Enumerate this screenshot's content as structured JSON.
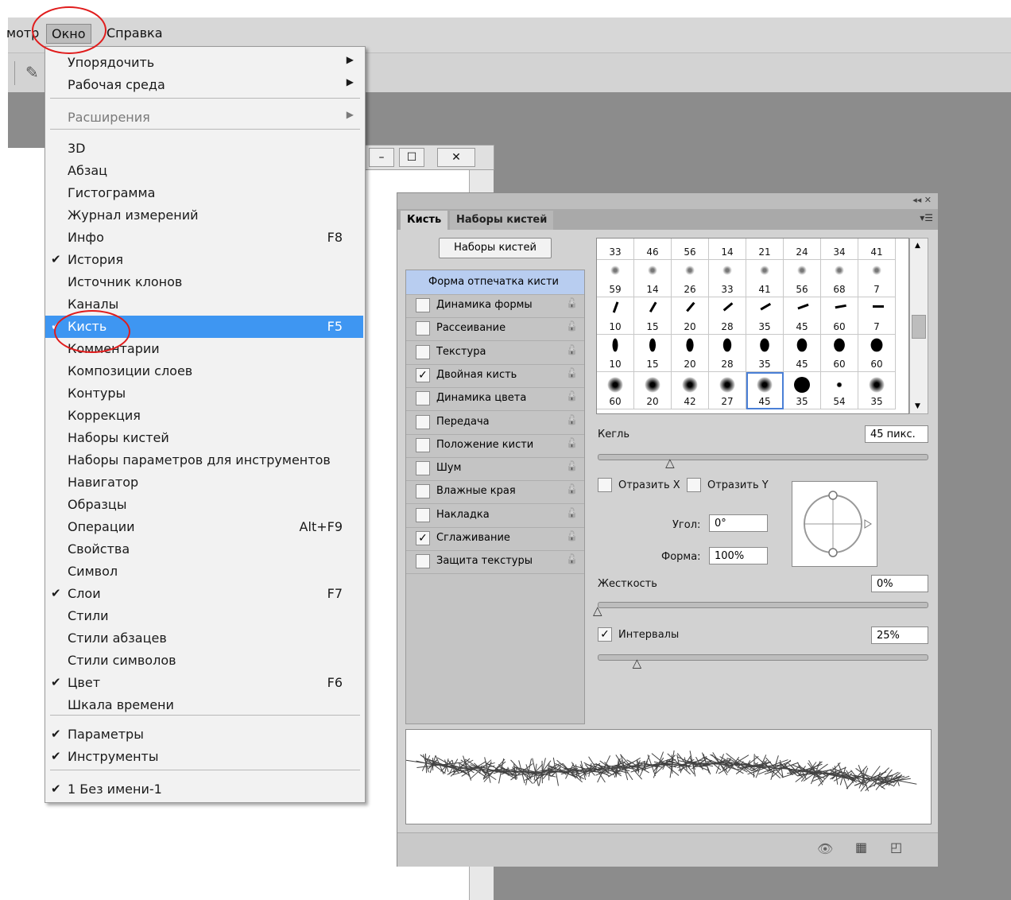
{
  "menubar": {
    "items": [
      {
        "label": "мотр"
      },
      {
        "label": "Окно"
      },
      {
        "label": "Справка"
      }
    ]
  },
  "doc_window": {
    "minimize": "–",
    "maximize": "☐",
    "close": "✕"
  },
  "window_menu": {
    "items": [
      {
        "label": "Упорядочить",
        "submenu": true
      },
      {
        "label": "Рабочая среда",
        "submenu": true
      },
      {
        "label": "Расширения",
        "submenu": true,
        "disabled": true
      },
      {
        "label": "3D"
      },
      {
        "label": "Абзац"
      },
      {
        "label": "Гистограмма"
      },
      {
        "label": "Журнал измерений"
      },
      {
        "label": "Инфо",
        "shortcut": "F8"
      },
      {
        "label": "История",
        "checked": true
      },
      {
        "label": "Источник клонов"
      },
      {
        "label": "Каналы"
      },
      {
        "label": "Кисть",
        "shortcut": "F5",
        "checked": true,
        "highlighted": true
      },
      {
        "label": "Комментарии"
      },
      {
        "label": "Композиции слоев"
      },
      {
        "label": "Контуры"
      },
      {
        "label": "Коррекция"
      },
      {
        "label": "Наборы кистей"
      },
      {
        "label": "Наборы параметров для инструментов"
      },
      {
        "label": "Навигатор"
      },
      {
        "label": "Образцы"
      },
      {
        "label": "Операции",
        "shortcut": "Alt+F9"
      },
      {
        "label": "Свойства"
      },
      {
        "label": "Символ"
      },
      {
        "label": "Слои",
        "shortcut": "F7",
        "checked": true
      },
      {
        "label": "Стили"
      },
      {
        "label": "Стили абзацев"
      },
      {
        "label": "Стили символов"
      },
      {
        "label": "Цвет",
        "shortcut": "F6",
        "checked": true
      },
      {
        "label": "Шкала времени"
      },
      {
        "label": "Параметры",
        "checked": true
      },
      {
        "label": "Инструменты",
        "checked": true
      },
      {
        "label": "1 Без имени-1",
        "checked": true
      }
    ]
  },
  "brush_panel": {
    "top_controls": "◂◂ ✕",
    "tabs": [
      {
        "label": "Кисть",
        "active": true
      },
      {
        "label": "Наборы кистей",
        "active": false
      }
    ],
    "menu_icon": "▾☰",
    "presets_button": "Наборы кистей",
    "options": [
      {
        "label": "Форма отпечатка кисти",
        "checkbox": false
      },
      {
        "label": "Динамика формы",
        "checked": false
      },
      {
        "label": "Рассеивание",
        "checked": false
      },
      {
        "label": "Текстура",
        "checked": false
      },
      {
        "label": "Двойная кисть",
        "checked": true
      },
      {
        "label": "Динамика цвета",
        "checked": false
      },
      {
        "label": "Передача",
        "checked": false
      },
      {
        "label": "Положение кисти",
        "checked": false
      },
      {
        "label": "Шум",
        "checked": false
      },
      {
        "label": "Влажные края",
        "checked": false
      },
      {
        "label": "Накладка",
        "checked": false
      },
      {
        "label": "Сглаживание",
        "checked": true
      },
      {
        "label": "Защита текстуры",
        "checked": false
      }
    ],
    "lock_glyph": "🔓",
    "check_glyph": "✓",
    "brush_tips": [
      [
        "33",
        "46",
        "56",
        "14",
        "21",
        "24",
        "34",
        "41"
      ],
      [
        "59",
        "14",
        "26",
        "33",
        "41",
        "56",
        "68",
        "7"
      ],
      [
        "10",
        "15",
        "20",
        "28",
        "35",
        "45",
        "60",
        "7"
      ],
      [
        "10",
        "15",
        "20",
        "28",
        "35",
        "45",
        "60",
        "60"
      ],
      [
        "60",
        "20",
        "42",
        "27",
        "45",
        "35",
        "54",
        "35"
      ]
    ],
    "selected_tip": {
      "row": 4,
      "col": 4
    },
    "size_label": "Кегль",
    "size_value": "45 пикс.",
    "size_slider": 0.22,
    "flip_x": "Отразить X",
    "flip_y": "Отразить Y",
    "angle_label": "Угол:",
    "angle_value": "0°",
    "roundness_label": "Форма:",
    "roundness_value": "100%",
    "hardness_label": "Жесткость",
    "hardness_value": "0%",
    "hardness_slider": 0.0,
    "spacing_label": "Интервалы",
    "spacing_checked": true,
    "spacing_value": "25%",
    "spacing_slider": 0.12,
    "footer_icons": [
      "eye-brush-icon",
      "grid-icon",
      "new-preset-icon"
    ]
  },
  "colors": {
    "highlight": "#3e96f2",
    "annotation": "#e01c1c"
  }
}
